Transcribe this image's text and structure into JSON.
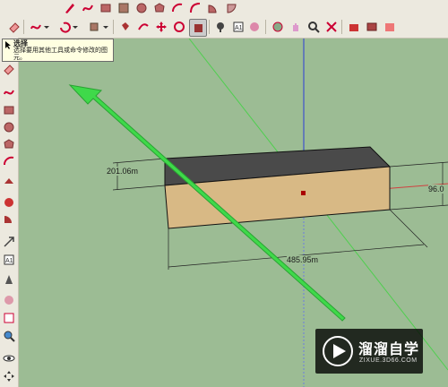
{
  "tooltip": {
    "title": "选择",
    "body": "选择要用其他工具或命令修改的图元。"
  },
  "dimensions": {
    "width_label": "485.95m",
    "depth_label": "201.06m",
    "height_label": "96.0"
  },
  "watermark": {
    "brand": "溜溜自学",
    "url": "ZIXUE.3D66.COM"
  },
  "icons_top": [
    "pencil-icon",
    "freehand-icon",
    "rectangle-icon",
    "circle-icon",
    "polygon-icon",
    "arc-icon",
    "pie-icon",
    "eraser-icon",
    "paint-bucket-icon",
    "rotate-icon",
    "scale-icon",
    "select-icon",
    "tape-icon",
    "text-icon",
    "paint-icon",
    "orbit-icon",
    "pan-icon",
    "zoom-icon",
    "zoom-extents-icon",
    "warehouse-icon",
    "component-icon",
    "export-icon"
  ],
  "icons_left": [
    "eraser-icon",
    "freehand-icon",
    "rectangle-icon",
    "circle-icon",
    "polygon-icon",
    "arc-icon",
    "push-pull-icon",
    "follow-me-icon",
    "offset-icon",
    "move-icon",
    "text-icon",
    "dimension-icon",
    "paint-icon",
    "zoom-window-icon",
    "zoom-icon",
    "eye-icon",
    "walk-icon"
  ]
}
